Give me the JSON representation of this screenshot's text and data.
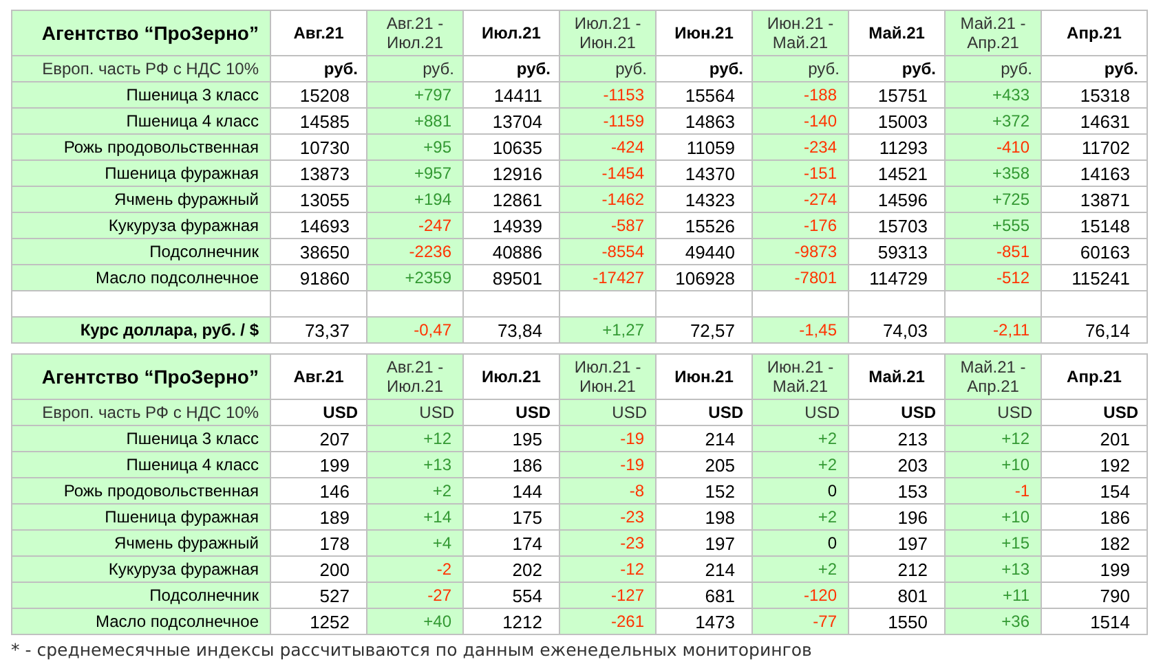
{
  "tables": [
    {
      "title": "Агентство “ПроЗерно”",
      "columns": [
        {
          "label": "Авг.21",
          "kind": "value"
        },
        {
          "label": "Авг.21 - Июл.21",
          "kind": "change"
        },
        {
          "label": "Июл.21",
          "kind": "value"
        },
        {
          "label": "Июл.21 - Июн.21",
          "kind": "change"
        },
        {
          "label": "Июн.21",
          "kind": "value"
        },
        {
          "label": "Июн.21 - Май.21",
          "kind": "change"
        },
        {
          "label": "Май.21",
          "kind": "value"
        },
        {
          "label": "Май.21 - Апр.21",
          "kind": "change"
        },
        {
          "label": "Апр.21",
          "kind": "value"
        }
      ],
      "unit_row": {
        "label": "Европ. часть РФ с НДС 10%",
        "units": [
          "руб.",
          "руб.",
          "руб.",
          "руб.",
          "руб.",
          "руб.",
          "руб.",
          "руб.",
          "руб."
        ]
      },
      "rows": [
        {
          "kind": "data",
          "label": "Пшеница 3 класс",
          "cells": [
            {
              "text": "15208"
            },
            {
              "text": "+797",
              "color": "#339933"
            },
            {
              "text": "14411"
            },
            {
              "text": "-1153",
              "color": "#ff3300"
            },
            {
              "text": "15564"
            },
            {
              "text": "-188",
              "color": "#ff3300"
            },
            {
              "text": "15751"
            },
            {
              "text": "+433",
              "color": "#339933"
            },
            {
              "text": "15318"
            }
          ]
        },
        {
          "kind": "data",
          "label": "Пшеница 4 класс",
          "cells": [
            {
              "text": "14585"
            },
            {
              "text": "+881",
              "color": "#339933"
            },
            {
              "text": "13704"
            },
            {
              "text": "-1159",
              "color": "#ff3300"
            },
            {
              "text": "14863"
            },
            {
              "text": "-140",
              "color": "#ff3300"
            },
            {
              "text": "15003"
            },
            {
              "text": "+372",
              "color": "#339933"
            },
            {
              "text": "14631"
            }
          ]
        },
        {
          "kind": "data",
          "label": "Рожь продовольственная",
          "cells": [
            {
              "text": "10730"
            },
            {
              "text": "+95",
              "color": "#339933"
            },
            {
              "text": "10635"
            },
            {
              "text": "-424",
              "color": "#ff3300"
            },
            {
              "text": "11059"
            },
            {
              "text": "-234",
              "color": "#ff3300"
            },
            {
              "text": "11293"
            },
            {
              "text": "-410",
              "color": "#ff3300"
            },
            {
              "text": "11702"
            }
          ]
        },
        {
          "kind": "data",
          "label": "Пшеница фуражная",
          "cells": [
            {
              "text": "13873"
            },
            {
              "text": "+957",
              "color": "#339933"
            },
            {
              "text": "12916"
            },
            {
              "text": "-1454",
              "color": "#ff3300"
            },
            {
              "text": "14370"
            },
            {
              "text": "-151",
              "color": "#ff3300"
            },
            {
              "text": "14521"
            },
            {
              "text": "+358",
              "color": "#339933"
            },
            {
              "text": "14163"
            }
          ]
        },
        {
          "kind": "data",
          "label": "Ячмень фуражный",
          "cells": [
            {
              "text": "13055"
            },
            {
              "text": "+194",
              "color": "#339933"
            },
            {
              "text": "12861"
            },
            {
              "text": "-1462",
              "color": "#ff3300"
            },
            {
              "text": "14323"
            },
            {
              "text": "-274",
              "color": "#ff3300"
            },
            {
              "text": "14596"
            },
            {
              "text": "+725",
              "color": "#339933"
            },
            {
              "text": "13871"
            }
          ]
        },
        {
          "kind": "data",
          "label": "Кукуруза фуражная",
          "cells": [
            {
              "text": "14693"
            },
            {
              "text": "-247",
              "color": "#ff3300"
            },
            {
              "text": "14939"
            },
            {
              "text": "-587",
              "color": "#ff3300"
            },
            {
              "text": "15526"
            },
            {
              "text": "-176",
              "color": "#ff3300"
            },
            {
              "text": "15703"
            },
            {
              "text": "+555",
              "color": "#339933"
            },
            {
              "text": "15148"
            }
          ]
        },
        {
          "kind": "data",
          "label": "Подсолнечник",
          "cells": [
            {
              "text": "38650"
            },
            {
              "text": "-2236",
              "color": "#ff3300"
            },
            {
              "text": "40886"
            },
            {
              "text": "-8554",
              "color": "#ff3300"
            },
            {
              "text": "49440"
            },
            {
              "text": "-9873",
              "color": "#ff3300"
            },
            {
              "text": "59313"
            },
            {
              "text": "-851",
              "color": "#ff3300"
            },
            {
              "text": "60163"
            }
          ]
        },
        {
          "kind": "data",
          "label": "Масло подсолнечное",
          "cells": [
            {
              "text": "91860"
            },
            {
              "text": "+2359",
              "color": "#339933"
            },
            {
              "text": "89501"
            },
            {
              "text": "-17427",
              "color": "#ff3300"
            },
            {
              "text": "106928"
            },
            {
              "text": "-7801",
              "color": "#ff3300"
            },
            {
              "text": "114729"
            },
            {
              "text": "-512",
              "color": "#ff3300"
            },
            {
              "text": "115241"
            }
          ]
        },
        {
          "kind": "blank"
        },
        {
          "kind": "rate",
          "label": "Курс доллара, руб. / $",
          "cells": [
            {
              "text": "73,37"
            },
            {
              "text": "-0,47",
              "color": "#ff3300"
            },
            {
              "text": "73,84"
            },
            {
              "text": "+1,27",
              "color": "#339933"
            },
            {
              "text": "72,57"
            },
            {
              "text": "-1,45",
              "color": "#ff3300"
            },
            {
              "text": "74,03"
            },
            {
              "text": "-2,11",
              "color": "#ff3300"
            },
            {
              "text": "76,14"
            }
          ]
        }
      ]
    },
    {
      "title": "Агентство “ПроЗерно”",
      "columns": [
        {
          "label": "Авг.21",
          "kind": "value"
        },
        {
          "label": "Авг.21 - Июл.21",
          "kind": "change"
        },
        {
          "label": "Июл.21",
          "kind": "value"
        },
        {
          "label": "Июл.21 - Июн.21",
          "kind": "change"
        },
        {
          "label": "Июн.21",
          "kind": "value"
        },
        {
          "label": "Июн.21 - Май.21",
          "kind": "change"
        },
        {
          "label": "Май.21",
          "kind": "value"
        },
        {
          "label": "Май.21 - Апр.21",
          "kind": "change"
        },
        {
          "label": "Апр.21",
          "kind": "value"
        }
      ],
      "unit_row": {
        "label": "Европ. часть РФ с НДС 10%",
        "units": [
          "USD",
          "USD",
          "USD",
          "USD",
          "USD",
          "USD",
          "USD",
          "USD",
          "USD"
        ]
      },
      "rows": [
        {
          "kind": "data",
          "label": "Пшеница 3 класс",
          "cells": [
            {
              "text": "207"
            },
            {
              "text": "+12",
              "color": "#339933"
            },
            {
              "text": "195"
            },
            {
              "text": "-19",
              "color": "#ff3300"
            },
            {
              "text": "214"
            },
            {
              "text": "+2",
              "color": "#339933"
            },
            {
              "text": "213"
            },
            {
              "text": "+12",
              "color": "#339933"
            },
            {
              "text": "201"
            }
          ]
        },
        {
          "kind": "data",
          "label": "Пшеница 4 класс",
          "cells": [
            {
              "text": "199"
            },
            {
              "text": "+13",
              "color": "#339933"
            },
            {
              "text": "186"
            },
            {
              "text": "-19",
              "color": "#ff3300"
            },
            {
              "text": "205"
            },
            {
              "text": "+2",
              "color": "#339933"
            },
            {
              "text": "203"
            },
            {
              "text": "+10",
              "color": "#339933"
            },
            {
              "text": "192"
            }
          ]
        },
        {
          "kind": "data",
          "label": "Рожь продовольственная",
          "cells": [
            {
              "text": "146"
            },
            {
              "text": "+2",
              "color": "#339933"
            },
            {
              "text": "144"
            },
            {
              "text": "-8",
              "color": "#ff3300"
            },
            {
              "text": "152"
            },
            {
              "text": "0",
              "color": "#000000"
            },
            {
              "text": "153"
            },
            {
              "text": "-1",
              "color": "#ff3300"
            },
            {
              "text": "154"
            }
          ]
        },
        {
          "kind": "data",
          "label": "Пшеница фуражная",
          "cells": [
            {
              "text": "189"
            },
            {
              "text": "+14",
              "color": "#339933"
            },
            {
              "text": "175"
            },
            {
              "text": "-23",
              "color": "#ff3300"
            },
            {
              "text": "198"
            },
            {
              "text": "+2",
              "color": "#339933"
            },
            {
              "text": "196"
            },
            {
              "text": "+10",
              "color": "#339933"
            },
            {
              "text": "186"
            }
          ]
        },
        {
          "kind": "data",
          "label": "Ячмень фуражный",
          "cells": [
            {
              "text": "178"
            },
            {
              "text": "+4",
              "color": "#339933"
            },
            {
              "text": "174"
            },
            {
              "text": "-23",
              "color": "#ff3300"
            },
            {
              "text": "197"
            },
            {
              "text": "0",
              "color": "#000000"
            },
            {
              "text": "197"
            },
            {
              "text": "+15",
              "color": "#339933"
            },
            {
              "text": "182"
            }
          ]
        },
        {
          "kind": "data",
          "label": "Кукуруза фуражная",
          "cells": [
            {
              "text": "200"
            },
            {
              "text": "-2",
              "color": "#ff3300"
            },
            {
              "text": "202"
            },
            {
              "text": "-12",
              "color": "#ff3300"
            },
            {
              "text": "214"
            },
            {
              "text": "+2",
              "color": "#339933"
            },
            {
              "text": "212"
            },
            {
              "text": "+13",
              "color": "#339933"
            },
            {
              "text": "199"
            }
          ]
        },
        {
          "kind": "data",
          "label": "Подсолнечник",
          "cells": [
            {
              "text": "527"
            },
            {
              "text": "-27",
              "color": "#ff3300"
            },
            {
              "text": "554"
            },
            {
              "text": "-127",
              "color": "#ff3300"
            },
            {
              "text": "681"
            },
            {
              "text": "-120",
              "color": "#ff3300"
            },
            {
              "text": "801"
            },
            {
              "text": "+11",
              "color": "#339933"
            },
            {
              "text": "790"
            }
          ]
        },
        {
          "kind": "data",
          "label": "Масло подсолнечное",
          "cells": [
            {
              "text": "1252"
            },
            {
              "text": "+40",
              "color": "#339933"
            },
            {
              "text": "1212"
            },
            {
              "text": "-261",
              "color": "#ff3300"
            },
            {
              "text": "1473"
            },
            {
              "text": "-77",
              "color": "#ff3300"
            },
            {
              "text": "1550"
            },
            {
              "text": "+36",
              "color": "#339933"
            },
            {
              "text": "1514"
            }
          ]
        }
      ]
    }
  ],
  "footnote": "* - среднемесячные индексы рассчитываются по данным еженедельных мониторингов"
}
